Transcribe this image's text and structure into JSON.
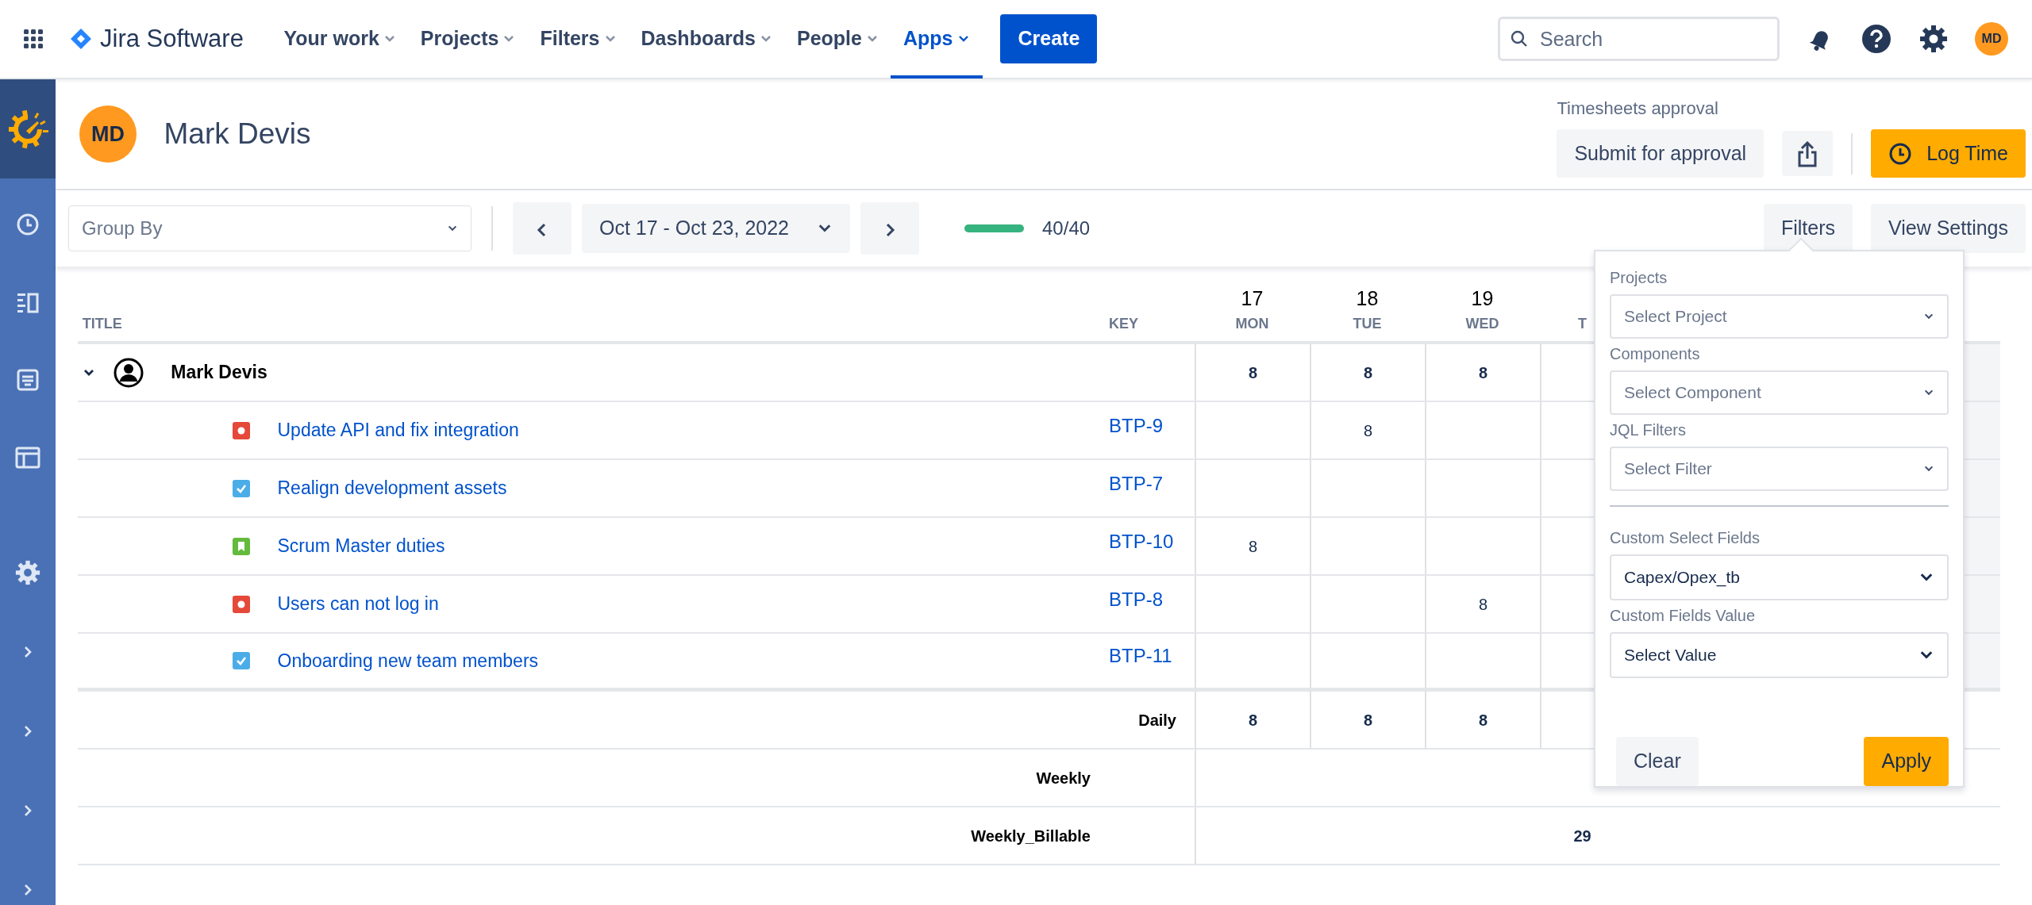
{
  "topnav": {
    "product": "Jira Software",
    "items": [
      {
        "label": "Your work",
        "selected": false
      },
      {
        "label": "Projects",
        "selected": false
      },
      {
        "label": "Filters",
        "selected": false
      },
      {
        "label": "Dashboards",
        "selected": false
      },
      {
        "label": "People",
        "selected": false
      },
      {
        "label": "Apps",
        "selected": true
      }
    ],
    "create": "Create",
    "search": {
      "placeholder": "Search"
    },
    "avatar": "MD"
  },
  "sidebar": {
    "items": [
      {
        "kind": "clock"
      },
      {
        "kind": "list"
      },
      {
        "kind": "document"
      },
      {
        "kind": "layout"
      },
      {
        "kind": "gear"
      },
      {
        "kind": "chevron"
      },
      {
        "kind": "chevron"
      },
      {
        "kind": "chevron"
      },
      {
        "kind": "chevron"
      }
    ]
  },
  "header": {
    "avatar": "MD",
    "name": "Mark Devis",
    "approval_label": "Timesheets approval",
    "submit": "Submit for approval",
    "log_time": "Log Time"
  },
  "toolbar": {
    "group_by": {
      "placeholder": "Group By"
    },
    "date_range": "Oct 17 - Oct 23, 2022",
    "progress": {
      "level": 1.0,
      "reading": "40/40"
    },
    "filters": "Filters",
    "view_settings": "View Settings"
  },
  "table": {
    "columns": {
      "title": "TITLE",
      "key": "KEY"
    },
    "days": [
      {
        "number": "17",
        "name": "MON"
      },
      {
        "number": "18",
        "name": "TUE"
      },
      {
        "number": "19",
        "name": "WED"
      },
      {
        "name": "T"
      }
    ],
    "group": {
      "name": "Mark Devis",
      "expanded": true,
      "hours": {
        "mon": "8",
        "tue": "8",
        "wed": "8"
      }
    },
    "rows": [
      {
        "kind": "bug",
        "title": "Update API and fix integration",
        "key": "BTP-9",
        "hours": {
          "tue": "8"
        }
      },
      {
        "kind": "task",
        "title": "Realign development assets",
        "key": "BTP-7",
        "hours": {}
      },
      {
        "kind": "story",
        "title": "Scrum Master duties",
        "key": "BTP-10",
        "hours": {
          "mon": "8"
        }
      },
      {
        "kind": "bug",
        "title": "Users can not log in",
        "key": "BTP-8",
        "hours": {
          "wed": "8"
        }
      },
      {
        "kind": "task",
        "title": "Onboarding new team members",
        "key": "BTP-11",
        "hours": {}
      }
    ],
    "daily": {
      "label": "Daily",
      "hours": {
        "mon": "8",
        "tue": "8",
        "wed": "8"
      }
    },
    "weekly": {
      "label": "Weekly"
    },
    "weekly_billable": {
      "label": "Weekly_Billable",
      "total": "29"
    }
  },
  "filter_panel": {
    "fields": [
      {
        "label": "Projects",
        "placeholder": "Select Project"
      },
      {
        "label": "Components",
        "placeholder": "Select Component"
      },
      {
        "label": "JQL Filters",
        "placeholder": "Select Filter"
      },
      {
        "label": "Custom Select Fields",
        "value": "Capex/Opex_tb"
      },
      {
        "label": "Custom Fields Value",
        "value": "Select Value"
      }
    ],
    "clear": "Clear",
    "apply": "Apply"
  }
}
